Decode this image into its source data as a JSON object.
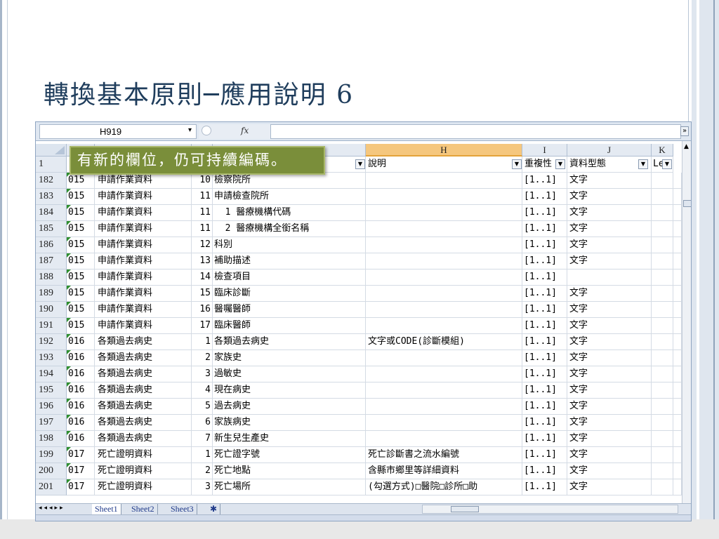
{
  "slide": {
    "title": "轉換基本原則─應用說明 6"
  },
  "excel": {
    "name_box": "H919",
    "fx_label": "fx",
    "columns": [
      {
        "id": "c",
        "label": ""
      },
      {
        "id": "d",
        "label": ""
      },
      {
        "id": "e",
        "label": ""
      },
      {
        "id": "f",
        "label": ""
      },
      {
        "id": "H",
        "label": "H"
      },
      {
        "id": "I",
        "label": "I"
      },
      {
        "id": "J",
        "label": "J"
      },
      {
        "id": "K",
        "label": "K"
      }
    ],
    "header_row": {
      "num": "1",
      "h": "說明",
      "i": "重複性",
      "j": "資料型態",
      "k": "Le"
    },
    "callout": "有新的欄位，仍可持續編碼。",
    "rows": [
      {
        "num": "182",
        "code": "015",
        "name": "申請作業資料",
        "seq": "10",
        "field": "檢察院所",
        "desc": "",
        "rep": "[1..1]",
        "type": "文字"
      },
      {
        "num": "183",
        "code": "015",
        "name": "申請作業資料",
        "seq": "11",
        "field": "申請檢查院所",
        "desc": "",
        "rep": "[1..1]",
        "type": "文字"
      },
      {
        "num": "184",
        "code": "015",
        "name": "申請作業資料",
        "seq": "11",
        "field": "  1 醫療機構代碼",
        "desc": "",
        "rep": "[1..1]",
        "type": "文字"
      },
      {
        "num": "185",
        "code": "015",
        "name": "申請作業資料",
        "seq": "11",
        "field": "  2 醫療機構全銜名稱",
        "desc": "",
        "rep": "[1..1]",
        "type": "文字"
      },
      {
        "num": "186",
        "code": "015",
        "name": "申請作業資料",
        "seq": "12",
        "field": "科別",
        "desc": "",
        "rep": "[1..1]",
        "type": "文字"
      },
      {
        "num": "187",
        "code": "015",
        "name": "申請作業資料",
        "seq": "13",
        "field": "補助描述",
        "desc": "",
        "rep": "[1..1]",
        "type": "文字"
      },
      {
        "num": "188",
        "code": "015",
        "name": "申請作業資料",
        "seq": "14",
        "field": "檢查項目",
        "desc": "",
        "rep": "[1..1]",
        "type": ""
      },
      {
        "num": "189",
        "code": "015",
        "name": "申請作業資料",
        "seq": "15",
        "field": "臨床診斷",
        "desc": "",
        "rep": "[1..1]",
        "type": "文字"
      },
      {
        "num": "190",
        "code": "015",
        "name": "申請作業資料",
        "seq": "16",
        "field": "醫囑醫師",
        "desc": "",
        "rep": "[1..1]",
        "type": "文字"
      },
      {
        "num": "191",
        "code": "015",
        "name": "申請作業資料",
        "seq": "17",
        "field": "臨床醫師",
        "desc": "",
        "rep": "[1..1]",
        "type": "文字"
      },
      {
        "num": "192",
        "code": "016",
        "name": "各類過去病史",
        "seq": "1",
        "field": "各類過去病史",
        "desc": "文字或CODE(診斷模組)",
        "rep": "[1..1]",
        "type": "文字"
      },
      {
        "num": "193",
        "code": "016",
        "name": "各類過去病史",
        "seq": "2",
        "field": "家族史",
        "desc": "",
        "rep": "[1..1]",
        "type": "文字"
      },
      {
        "num": "194",
        "code": "016",
        "name": "各類過去病史",
        "seq": "3",
        "field": "過敏史",
        "desc": "",
        "rep": "[1..1]",
        "type": "文字"
      },
      {
        "num": "195",
        "code": "016",
        "name": "各類過去病史",
        "seq": "4",
        "field": "現在病史",
        "desc": "",
        "rep": "[1..1]",
        "type": "文字"
      },
      {
        "num": "196",
        "code": "016",
        "name": "各類過去病史",
        "seq": "5",
        "field": "過去病史",
        "desc": "",
        "rep": "[1..1]",
        "type": "文字"
      },
      {
        "num": "197",
        "code": "016",
        "name": "各類過去病史",
        "seq": "6",
        "field": "家族病史",
        "desc": "",
        "rep": "[1..1]",
        "type": "文字"
      },
      {
        "num": "198",
        "code": "016",
        "name": "各類過去病史",
        "seq": "7",
        "field": "新生兒生產史",
        "desc": "",
        "rep": "[1..1]",
        "type": "文字"
      },
      {
        "num": "199",
        "code": "017",
        "name": "死亡證明資料",
        "seq": "1",
        "field": "死亡證字號",
        "desc": "死亡診斷書之流水編號",
        "rep": "[1..1]",
        "type": "文字"
      },
      {
        "num": "200",
        "code": "017",
        "name": "死亡證明資料",
        "seq": "2",
        "field": "死亡地點",
        "desc": "含縣市鄉里等詳細資料",
        "rep": "[1..1]",
        "type": "文字"
      },
      {
        "num": "201",
        "code": "017",
        "name": "死亡證明資料",
        "seq": "3",
        "field": "死亡場所",
        "desc": "(勾選方式)□醫院□診所□助",
        "rep": "[1..1]",
        "type": "文字"
      }
    ],
    "sheet_tabs": [
      "Sheet1",
      "Sheet2",
      "Sheet3"
    ]
  }
}
